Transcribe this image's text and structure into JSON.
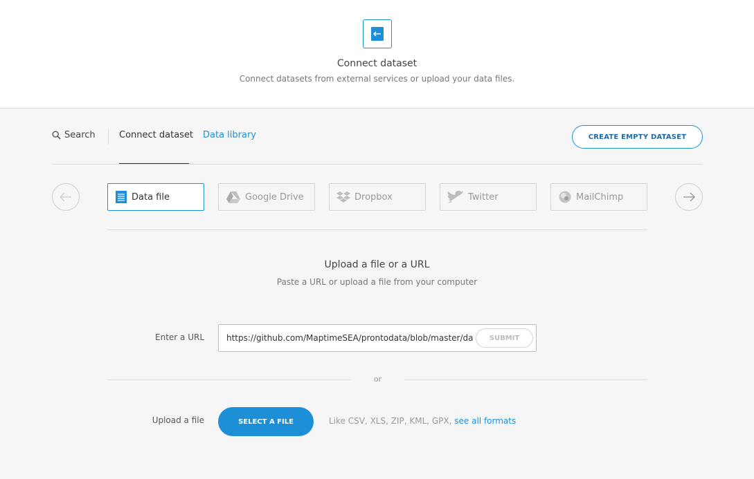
{
  "header": {
    "icon": "connect-dataset-icon",
    "title": "Connect dataset",
    "subtitle": "Connect datasets from external services or upload your data files."
  },
  "tabs": {
    "search_label": "Search",
    "connect_label": "Connect dataset",
    "library_label": "Data library",
    "create_button": "CREATE EMPTY DATASET"
  },
  "sources": [
    {
      "label": "Data file",
      "icon": "data-file-icon",
      "active": true
    },
    {
      "label": "Google Drive",
      "icon": "google-drive-icon",
      "active": false
    },
    {
      "label": "Dropbox",
      "icon": "dropbox-icon",
      "active": false
    },
    {
      "label": "Twitter",
      "icon": "twitter-icon",
      "active": false
    },
    {
      "label": "MailChimp",
      "icon": "mailchimp-icon",
      "active": false
    }
  ],
  "upload": {
    "title": "Upload a file or a URL",
    "subtitle": "Paste a URL or upload a file from your computer",
    "url_label": "Enter a URL",
    "url_value": "https://github.com/MaptimeSEA/prontodata/blob/master/data",
    "submit_label": "SUBMIT",
    "or_label": "or",
    "file_label": "Upload a file",
    "select_button": "SELECT A FILE",
    "formats_text": "Like CSV, XLS, ZIP, KML, GPX, ",
    "formats_link": "see all formats"
  },
  "colors": {
    "accent": "#1d8fd6",
    "background": "#f6f6f6",
    "header_bg": "#ffffff"
  }
}
